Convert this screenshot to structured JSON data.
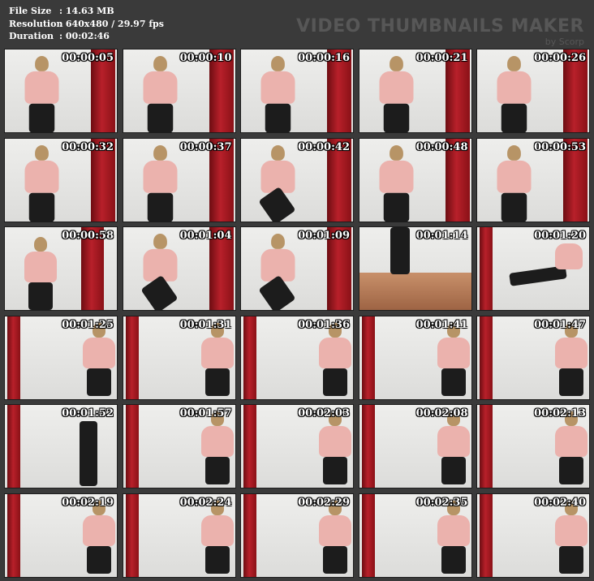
{
  "info": {
    "rows": [
      {
        "label": "File Size",
        "value": ": 14.63 MB"
      },
      {
        "label": "Resolution",
        "value": ": 640x480 / 29.97 fps"
      },
      {
        "label": "Duration",
        "value": ": 00:02:46"
      }
    ]
  },
  "brand": {
    "title": "VIDEO THUMBNAILS MAKER",
    "subtitle": "by Scorp"
  },
  "thumbnails": [
    {
      "time": "00:00:05",
      "scene": "standing-bag-right"
    },
    {
      "time": "00:00:10",
      "scene": "standing-bag-right"
    },
    {
      "time": "00:00:16",
      "scene": "standing-bag-right"
    },
    {
      "time": "00:00:21",
      "scene": "standing-bag-right"
    },
    {
      "time": "00:00:26",
      "scene": "standing-bag-right"
    },
    {
      "time": "00:00:32",
      "scene": "standing-bag-right"
    },
    {
      "time": "00:00:37",
      "scene": "standing-bag-right"
    },
    {
      "time": "00:00:42",
      "scene": "kick-bag-right"
    },
    {
      "time": "00:00:48",
      "scene": "standing-bag-right"
    },
    {
      "time": "00:00:53",
      "scene": "standing-bag-right"
    },
    {
      "time": "00:00:58",
      "scene": "standing-bag-mid"
    },
    {
      "time": "00:01:04",
      "scene": "kick-bag-right"
    },
    {
      "time": "00:01:09",
      "scene": "kick-bag-right"
    },
    {
      "time": "00:01:14",
      "scene": "floor"
    },
    {
      "time": "00:01:20",
      "scene": "kick-bag-left"
    },
    {
      "time": "00:01:25",
      "scene": "person-right-bag-left"
    },
    {
      "time": "00:01:31",
      "scene": "person-right-bag-left"
    },
    {
      "time": "00:01:36",
      "scene": "person-right-bag-left"
    },
    {
      "time": "00:01:41",
      "scene": "person-right-bag-left"
    },
    {
      "time": "00:01:47",
      "scene": "person-right-bag-left"
    },
    {
      "time": "00:01:52",
      "scene": "legs-right-bag-left"
    },
    {
      "time": "00:01:57",
      "scene": "person-right-bag-left"
    },
    {
      "time": "00:02:03",
      "scene": "person-right-bag-left"
    },
    {
      "time": "00:02:08",
      "scene": "person-right-bag-left"
    },
    {
      "time": "00:02:13",
      "scene": "person-right-bag-left"
    },
    {
      "time": "00:02:19",
      "scene": "person-right-bag-left"
    },
    {
      "time": "00:02:24",
      "scene": "person-right-bag-left"
    },
    {
      "time": "00:02:29",
      "scene": "person-right-bag-left"
    },
    {
      "time": "00:02:35",
      "scene": "person-right-bag-left"
    },
    {
      "time": "00:02:40",
      "scene": "person-right-bag-left"
    }
  ],
  "colors": {
    "background": "#3a3a3a",
    "bag": "#b8202a",
    "shirt": "#ebb2ad",
    "pants": "#1c1c1c",
    "wall": "#e8e8e6"
  }
}
